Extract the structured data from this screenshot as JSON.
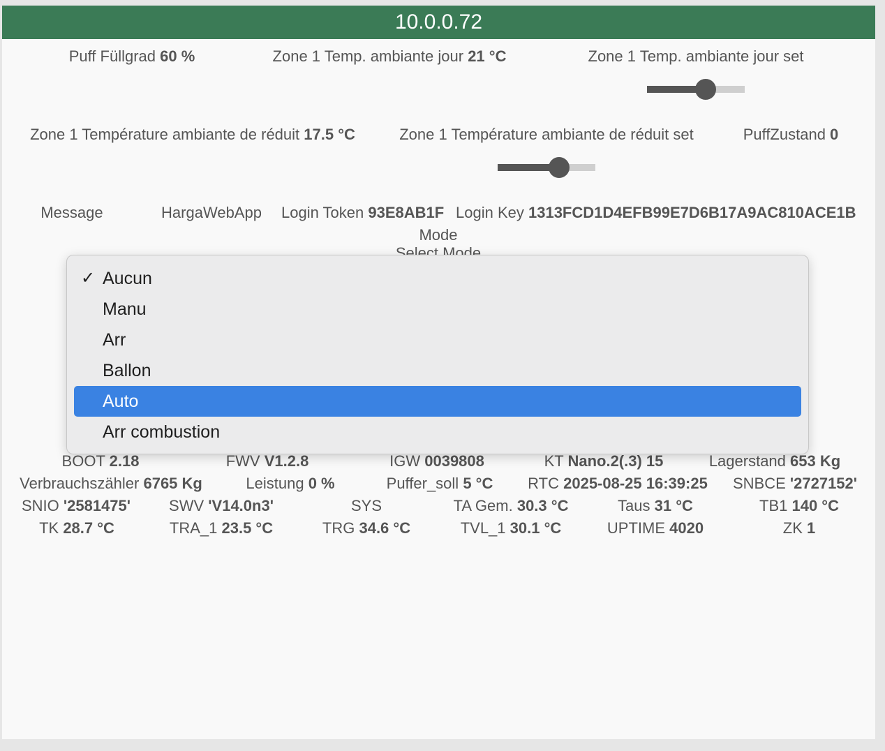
{
  "header": {
    "title": "10.0.0.72"
  },
  "row1": {
    "puff_label": "Puff Füllgrad",
    "puff_value": "60 %",
    "zone1_day_label": "Zone 1 Temp. ambiante jour",
    "zone1_day_value": "21 °C",
    "zone1_day_set_label": "Zone 1 Temp. ambiante jour set",
    "zone1_day_set_level": 0.6
  },
  "row2": {
    "reduced_label": "Zone 1 Température ambiante de réduit",
    "reduced_value": "17.5 °C",
    "reduced_set_label": "Zone 1 Température ambiante de réduit set",
    "reduced_set_level": 0.63,
    "puffzustand_label": "PuffZustand",
    "puffzustand_value": "0"
  },
  "row3": {
    "message_label": "Message",
    "app_label": "HargaWebApp",
    "token_label": "Login Token",
    "token_value": "93E8AB1F",
    "key_label": "Login Key",
    "key_value": "1313FCD1D4EFB99E7D6B17A9AC810ACE1B"
  },
  "mode": {
    "label": "Mode",
    "select_label": "Select Mode",
    "checkmark": "✓",
    "options": [
      "Aucun",
      "Manu",
      "Arr",
      "Ballon",
      "Auto",
      "Arr combustion"
    ],
    "checked": "Aucun",
    "highlighted": "Auto"
  },
  "row4": {
    "boot_label": "BOOT",
    "boot_value": "2.18",
    "fwv_label": "FWV",
    "fwv_value": "V1.2.8",
    "igw_label": "IGW",
    "igw_value": "0039808",
    "kt_label": "KT",
    "kt_value": "Nano.2(.3) 15",
    "lager_label": "Lagerstand",
    "lager_value": "653 Kg"
  },
  "row5": {
    "verb_label": "Verbrauchszähler",
    "verb_value": "6765 Kg",
    "leist_label": "Leistung",
    "leist_value": "0 %",
    "puffer_label": "Puffer_soll",
    "puffer_value": "5 °C",
    "rtc_label": "RTC",
    "rtc_value": "2025-08-25 16:39:25",
    "snbce_label": "SNBCE",
    "snbce_value": "'2727152'"
  },
  "row6": {
    "snio_label": "SNIO",
    "snio_value": "'2581475'",
    "swv_label": "SWV",
    "swv_value": "'V14.0n3'",
    "sys_label": "SYS",
    "tagem_label": "TA Gem.",
    "tagem_value": "30.3 °C",
    "taus_label": "Taus",
    "taus_value": "31 °C",
    "tb1_label": "TB1",
    "tb1_value": "140 °C"
  },
  "row7": {
    "tk_label": "TK",
    "tk_value": "28.7 °C",
    "tra_label": "TRA_1",
    "tra_value": "23.5 °C",
    "trg_label": "TRG",
    "trg_value": "34.6 °C",
    "tvl_label": "TVL_1",
    "tvl_value": "30.1 °C",
    "uptime_label": "UPTIME",
    "uptime_value": "4020",
    "zk_label": "ZK",
    "zk_value": "1"
  }
}
